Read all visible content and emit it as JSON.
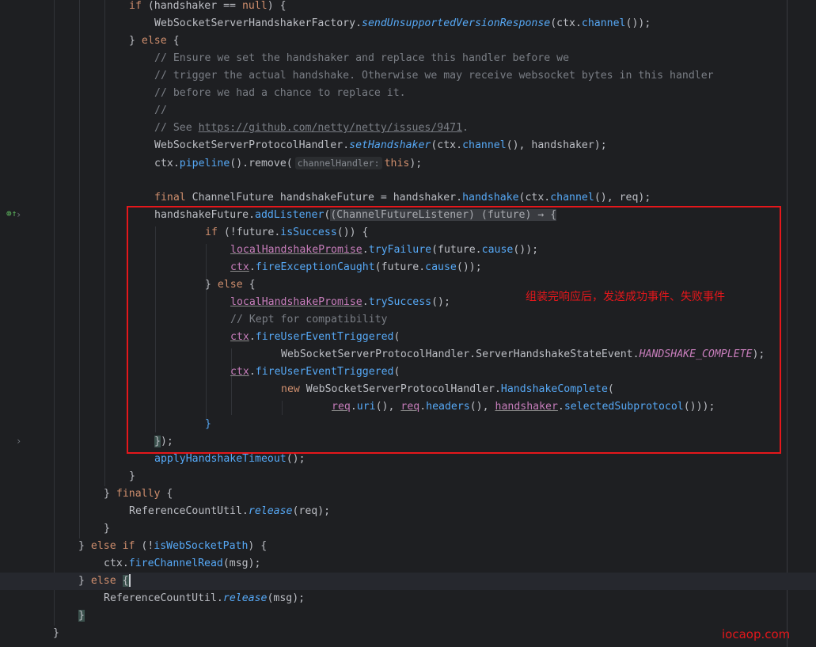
{
  "gutter": {
    "override_icon": "implements-method-icon",
    "fold_icon_1": "›",
    "fold_icon_2": "›"
  },
  "annotation": {
    "text": "组装完响应后，发送成功事件、失败事件"
  },
  "watermark": {
    "text": "iocaop.com"
  },
  "colors": {
    "highlight_box": "#e5171b",
    "background": "#1e1f22",
    "keyword": "#cf8e6d",
    "method": "#56a8f5",
    "field": "#c77dbb",
    "comment": "#7a7e85"
  },
  "code": {
    "l1": [
      "if",
      " (handshaker == ",
      "null",
      ") {"
    ],
    "l2": [
      "WebSocketServerHandshakerFactory",
      ".",
      "sendUnsupportedVersionResponse",
      "(ctx.",
      "channel",
      "());"
    ],
    "l3": [
      "} ",
      "else",
      " {"
    ],
    "l4": [
      "// Ensure we set the handshaker and replace this handler before we"
    ],
    "l5": [
      "// trigger the actual handshake. Otherwise we may receive websocket bytes in this handler"
    ],
    "l6": [
      "// before we had a chance to replace it."
    ],
    "l7": [
      "//"
    ],
    "l8": [
      "// See ",
      "https://github.com/netty/netty/issues/9471",
      "."
    ],
    "l9": [
      "WebSocketServerProtocolHandler",
      ".",
      "setHandshaker",
      "(ctx.",
      "channel",
      "(), handshaker);"
    ],
    "l10": [
      "ctx.",
      "pipeline",
      "().remove(",
      "channelHandler:",
      "this",
      ");"
    ],
    "l11": [
      "final",
      " ",
      "ChannelFuture",
      " handshakeFuture = handshaker.",
      "handshake",
      "(ctx.",
      "channel",
      "(), req);"
    ],
    "l12": [
      "handshakeFuture.",
      "addListener",
      "(",
      "(ChannelFutureListener) (future) → {"
    ],
    "l13": [
      "if",
      " (!future.",
      "isSuccess",
      "()) {"
    ],
    "l14": [
      "localHandshakePromise",
      ".",
      "tryFailure",
      "(future.",
      "cause",
      "());"
    ],
    "l15": [
      "ctx",
      ".",
      "fireExceptionCaught",
      "(future.",
      "cause",
      "());"
    ],
    "l16": [
      "} ",
      "else",
      " {"
    ],
    "l17": [
      "localHandshakePromise",
      ".",
      "trySuccess",
      "();"
    ],
    "l18": [
      "// Kept for compatibility"
    ],
    "l19": [
      "ctx",
      ".",
      "fireUserEventTriggered",
      "("
    ],
    "l20": [
      "WebSocketServerProtocolHandler.ServerHandshakeStateEvent.",
      "HANDSHAKE_COMPLETE",
      ");"
    ],
    "l21": [
      "ctx",
      ".",
      "fireUserEventTriggered",
      "("
    ],
    "l22": [
      "new",
      " WebSocketServerProtocolHandler.",
      "HandshakeComplete",
      "("
    ],
    "l23": [
      "req",
      ".",
      "uri",
      "(), ",
      "req",
      ".",
      "headers",
      "(), ",
      "handshaker",
      ".",
      "selectedSubprotocol",
      "()));"
    ],
    "l24": [
      "}"
    ],
    "l25": [
      "}",
      ");"
    ],
    "l26": [
      "applyHandshakeTimeout",
      "();"
    ],
    "l27": [
      "}"
    ],
    "l28": [
      "} ",
      "finally",
      " {"
    ],
    "l29": [
      "ReferenceCountUtil",
      ".",
      "release",
      "(req);"
    ],
    "l30": [
      "}"
    ],
    "l31": [
      "} ",
      "else if",
      " (!",
      "isWebSocketPath",
      ") {"
    ],
    "l32": [
      "ctx.",
      "fireChannelRead",
      "(msg);"
    ],
    "l33": [
      "} ",
      "else",
      " ",
      "{"
    ],
    "l34": [
      "ReferenceCountUtil",
      ".",
      "release",
      "(msg);"
    ],
    "l35": [
      "}"
    ],
    "l36": [
      "}"
    ]
  }
}
